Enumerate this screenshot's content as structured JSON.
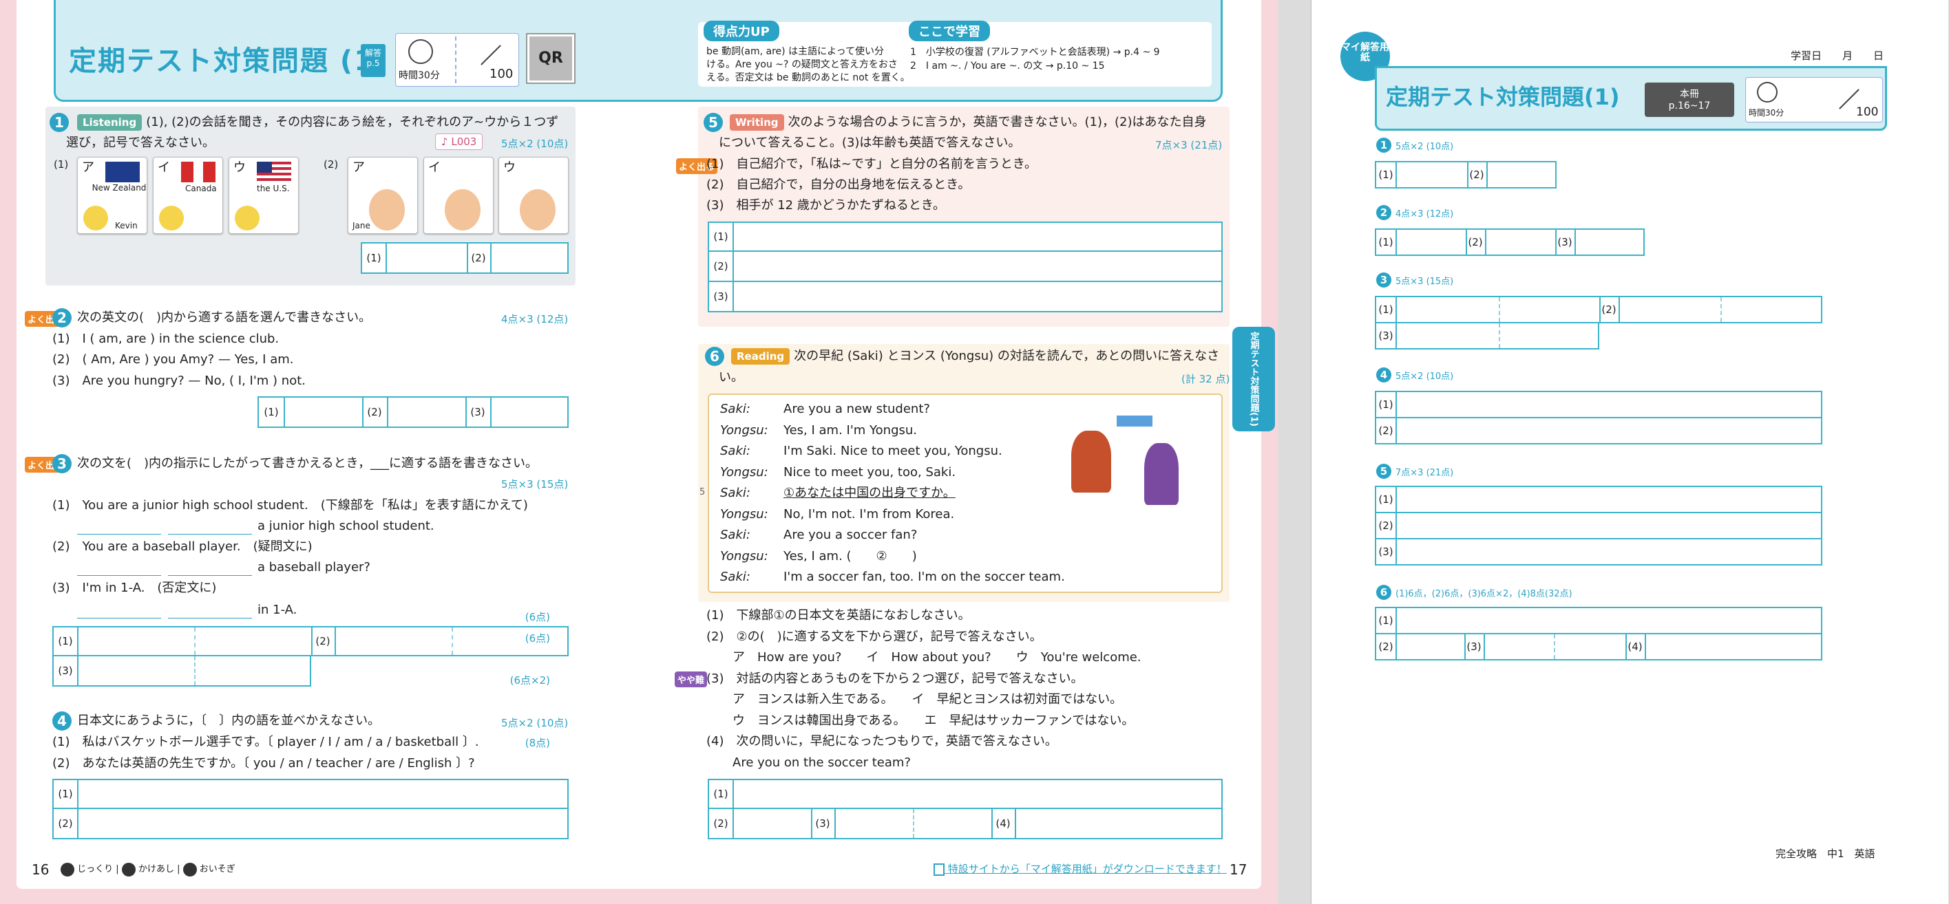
{
  "spread": {
    "title": "定期テスト対策問題 (1)",
    "kaito": "解答",
    "kaito_page": "p.5",
    "time_label": "時間30分",
    "score_total": "100",
    "qr": "QR",
    "tokuten": {
      "badge": "得点力UP",
      "text": [
        "be 動詞(am, are) は主語によって使い分",
        "ける。Are you ~? の疑問文と答え方をおさ",
        "える。否定文は be 動詞のあとに not を置く。"
      ]
    },
    "koko": {
      "badge": "ここで学習",
      "items": [
        "1　小学校の復習 (アルファベットと会話表現) → p.4 ~ 9",
        "2　I am ~. / You are ~. の文 → p.10 ~ 15"
      ]
    },
    "q1": {
      "num": "1",
      "chip": "Listening",
      "line1": "(1), (2)の会話を聞き，その内容にあう絵を，それぞれのア~ウから１つず",
      "line2": "選び，記号で答えなさい。",
      "track": "♪ L003",
      "points": "5点×2 (10点)",
      "p1": {
        "label": "(1)",
        "items": [
          {
            "k": "ア",
            "c": "New Zealand",
            "n": "Kevin"
          },
          {
            "k": "イ",
            "c": "Canada",
            "n": ""
          },
          {
            "k": "ウ",
            "c": "the U.S.",
            "n": ""
          }
        ]
      },
      "p2": {
        "label": "(2)",
        "items": [
          {
            "k": "ア",
            "n": "Jane"
          },
          {
            "k": "イ",
            "n": ""
          },
          {
            "k": "ウ",
            "n": ""
          }
        ]
      },
      "ans": [
        "(1)",
        "(2)"
      ]
    },
    "q2": {
      "num": "2",
      "yoku": "よく出る",
      "text": "次の英文の(　)内から適する語を選んで書きなさい。",
      "points": "4点×3 (12点)",
      "lines": [
        "(1)　I ( am,  are ) in the science club.",
        "(2)　( Am,  Are ) you Amy? — Yes, I am.",
        "(3)　Are you hungry? — No, ( I,  I'm ) not."
      ],
      "ans": [
        "(1)",
        "(2)",
        "(3)"
      ]
    },
    "q3": {
      "num": "3",
      "yoku": "よく出る",
      "text": "次の文を(　)内の指示にしたがって書きかえるとき，___に適する語を書きなさい。",
      "points": "5点×3 (15点)",
      "lines": [
        "(1)　You are a junior high school student.　(下線部を「私は」を表す語にかえて)",
        "a junior high school student.",
        "(2)　You are a baseball player.　(疑問文に)",
        "a baseball player?",
        "(3)　I'm in 1-A.　(否定文に)",
        "in 1-A."
      ],
      "ans": [
        "(1)",
        "(2)",
        "(3)"
      ]
    },
    "q4": {
      "num": "4",
      "text": "日本文にあうように，〔　〕内の語を並べかえなさい。",
      "points": "5点×2 (10点)",
      "lines": [
        "(1)　私はバスケットボール選手です。〔 player / I / am / a / basketball 〕.",
        "(2)　あなたは英語の先生ですか。〔 you / an / teacher / are / English 〕?"
      ],
      "ans": [
        "(1)",
        "(2)"
      ]
    },
    "q5": {
      "num": "5",
      "chip": "Writing",
      "line1": "次のような場合のように言うか，英語で書きなさい。(1)，(2)はあなた自身",
      "line2": "について答えること。(3)は年齢も英語で答えなさい。",
      "points": "7点×3 (21点)",
      "yoku": "よく出る",
      "lines": [
        "(1)　自己紹介で，「私は~です」と自分の名前を言うとき。",
        "(2)　自己紹介で，自分の出身地を伝えるとき。",
        "(3)　相手が 12 歳かどうかたずねるとき。"
      ],
      "ans": [
        "(1)",
        "(2)",
        "(3)"
      ]
    },
    "q6": {
      "num": "6",
      "chip": "Reading",
      "line1": "次の早紀 (Saki) とヨンス (Yongsu) の対話を読んで，あとの問いに答えなさ",
      "line2": "い。",
      "points": "(計 32 点)",
      "linemark": "5",
      "dialog": [
        [
          "Saki:",
          "Are you a new student?"
        ],
        [
          "Yongsu:",
          "Yes, I am.   I'm Yongsu."
        ],
        [
          "Saki:",
          "I'm Saki.   Nice to meet you, Yongsu."
        ],
        [
          "Yongsu:",
          "Nice to meet you, too, Saki."
        ],
        [
          "Saki:",
          "①あなたは中国の出身ですか。"
        ],
        [
          "Yongsu:",
          "No, I'm not.   I'm from Korea."
        ],
        [
          "Saki:",
          "Are you a soccer fan?"
        ],
        [
          "Yongsu:",
          "Yes, I am.   (　　②　　)"
        ],
        [
          "Saki:",
          "I'm a soccer fan, too.   I'm on the soccer team."
        ]
      ],
      "qs": [
        [
          "(1)　下線部①の日本文を英語になおしなさい。",
          "(6点)"
        ],
        [
          "(2)　②の(　)に適する文を下から選び，記号で答えなさい。",
          "(6点)"
        ],
        [
          "ア　How are you?　　イ　How about you?　　ウ　You're welcome.",
          ""
        ],
        [
          "(3)　対話の内容とあうものを下から２つ選び，記号で答えなさい。",
          "(6点×2)"
        ],
        [
          "ア　ヨンスは新入生である。　　イ　早紀とヨンスは初対面ではない。",
          ""
        ],
        [
          "ウ　ヨンスは韓国出身である。　　エ　早紀はサッカーファンではない。",
          ""
        ],
        [
          "(4)　次の問いに，早紀になったつもりで，英語で答えなさい。",
          "(8点)"
        ],
        [
          "Are you on the soccer team?",
          ""
        ]
      ],
      "yaya": "やや難",
      "ans": [
        "(1)",
        "(2)",
        "(3)",
        "(4)"
      ]
    },
    "side": "定期テスト対策問題(1)",
    "footer": {
      "left_page": "16",
      "legend": [
        "じっくり",
        "かけあし",
        "おいそぎ"
      ],
      "right_page": "17",
      "download": "特設サイトから「マイ解答用紙」がダウンロードできます！"
    }
  },
  "mysheet": {
    "badge": "マイ解答用紙",
    "date": "学習日　　月　　日",
    "title": "定期テスト対策問題(1)",
    "honsatsu": "本冊",
    "honsatsu_pages": "p.16~17",
    "time_label": "時間30分",
    "score_total": "100",
    "q": [
      {
        "n": "1",
        "pts": "5点×2 (10点)"
      },
      {
        "n": "2",
        "pts": "4点×3 (12点)"
      },
      {
        "n": "3",
        "pts": "5点×3 (15点)"
      },
      {
        "n": "4",
        "pts": "5点×2 (10点)"
      },
      {
        "n": "5",
        "pts": "7点×3 (21点)"
      },
      {
        "n": "6",
        "pts": "(1)6点，(2)6点，(3)6点×2，(4)8点(32点)"
      }
    ],
    "labels": {
      "a1": "(1)",
      "a2": "(2)",
      "a3": "(3)",
      "a4": "(4)"
    },
    "footer": "完全攻略　中1　英語"
  }
}
